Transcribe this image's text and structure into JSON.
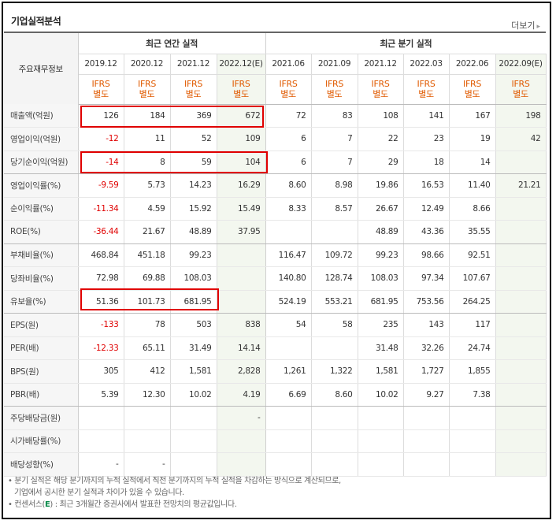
{
  "title": "기업실적분석",
  "more_label": "더보기",
  "header": {
    "row_label": "주요재무정보",
    "annual_group": "최근 연간 실적",
    "quarter_group": "최근 분기 실적",
    "annual_periods": [
      "2019.12",
      "2020.12",
      "2021.12",
      "2022.12(E)"
    ],
    "quarter_periods": [
      "2021.06",
      "2021.09",
      "2021.12",
      "2022.03",
      "2022.06",
      "2022.09(E)"
    ],
    "ifrs_top": "IFRS",
    "ifrs_bottom": "별도"
  },
  "rows": [
    {
      "label": "매출액(억원)",
      "values": [
        "126",
        "184",
        "369",
        "672",
        "72",
        "83",
        "108",
        "141",
        "167",
        "198"
      ]
    },
    {
      "label": "영업이익(억원)",
      "values": [
        "-12",
        "11",
        "52",
        "109",
        "6",
        "7",
        "22",
        "23",
        "19",
        "42"
      ]
    },
    {
      "label": "당기순이익(억원)",
      "values": [
        "-14",
        "8",
        "59",
        "104",
        "6",
        "7",
        "29",
        "18",
        "14",
        ""
      ]
    },
    {
      "label": "영업이익률(%)",
      "values": [
        "-9.59",
        "5.73",
        "14.23",
        "16.29",
        "8.60",
        "8.98",
        "19.86",
        "16.53",
        "11.40",
        "21.21"
      ]
    },
    {
      "label": "순이익률(%)",
      "values": [
        "-11.34",
        "4.59",
        "15.92",
        "15.49",
        "8.33",
        "8.57",
        "26.67",
        "12.49",
        "8.66",
        ""
      ]
    },
    {
      "label": "ROE(%)",
      "values": [
        "-36.44",
        "21.67",
        "48.89",
        "37.95",
        "",
        "",
        "48.89",
        "43.36",
        "35.55",
        ""
      ]
    },
    {
      "label": "부채비율(%)",
      "values": [
        "468.84",
        "451.18",
        "99.23",
        "",
        "116.47",
        "109.72",
        "99.23",
        "98.66",
        "92.51",
        ""
      ]
    },
    {
      "label": "당좌비율(%)",
      "values": [
        "72.98",
        "69.88",
        "108.03",
        "",
        "140.80",
        "128.74",
        "108.03",
        "97.34",
        "107.67",
        ""
      ]
    },
    {
      "label": "유보율(%)",
      "values": [
        "51.36",
        "101.73",
        "681.95",
        "",
        "524.19",
        "553.21",
        "681.95",
        "753.56",
        "264.25",
        ""
      ]
    },
    {
      "label": "EPS(원)",
      "values": [
        "-133",
        "78",
        "503",
        "838",
        "54",
        "58",
        "235",
        "143",
        "117",
        ""
      ]
    },
    {
      "label": "PER(배)",
      "values": [
        "-12.33",
        "65.11",
        "31.49",
        "14.14",
        "",
        "",
        "31.48",
        "32.26",
        "24.74",
        ""
      ]
    },
    {
      "label": "BPS(원)",
      "values": [
        "305",
        "412",
        "1,581",
        "2,828",
        "1,261",
        "1,322",
        "1,581",
        "1,727",
        "1,855",
        ""
      ]
    },
    {
      "label": "PBR(배)",
      "values": [
        "5.39",
        "12.30",
        "10.02",
        "4.19",
        "6.69",
        "8.60",
        "10.02",
        "9.27",
        "7.38",
        ""
      ]
    },
    {
      "label": "주당배당금(원)",
      "values": [
        "",
        "",
        "",
        "-",
        "",
        "",
        "",
        "",
        "",
        ""
      ]
    },
    {
      "label": "시가배당률(%)",
      "values": [
        "",
        "",
        "",
        "",
        "",
        "",
        "",
        "",
        "",
        ""
      ]
    },
    {
      "label": "배당성향(%)",
      "values": [
        "-",
        "-",
        "",
        "",
        "",
        "",
        "",
        "",
        "",
        ""
      ]
    }
  ],
  "notes": {
    "line1": "• 분기 실적은 해당 분기까지의 누적 실적에서 직전 분기까지의 누적 실적을 차감하는 방식으로 계산되므로,",
    "line2": "기업에서 공시한 분기 실적과 차이가 있을 수 있습니다.",
    "line3_prefix": "• 컨센서스(",
    "line3_e": "E",
    "line3_suffix": ") : 최근 3개월간 증권사에서 발표한 전망치의 평균값입니다."
  },
  "colors": {
    "negative": "#e00000",
    "ifrs": "#e05a00",
    "highlight": "#e00000",
    "estimate_bg": "#f3f7ef"
  }
}
